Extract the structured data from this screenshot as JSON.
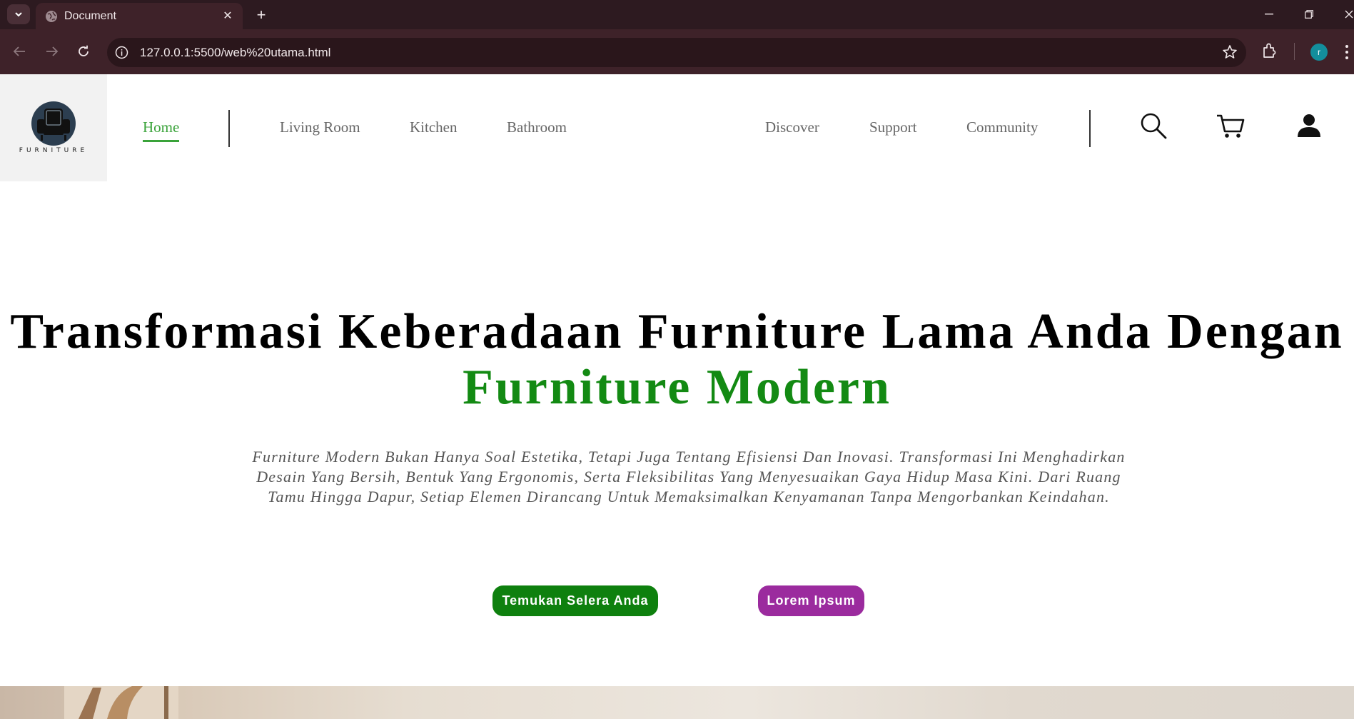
{
  "browser": {
    "tab_title": "Document",
    "url": "127.0.0.1:5500/web%20utama.html",
    "profile_initial": "r",
    "icons": [
      "tab-search-icon",
      "globe-icon",
      "close-icon",
      "plus-icon",
      "minimize-icon",
      "restore-icon",
      "close-window-icon",
      "back-arrow-icon",
      "forward-arrow-icon",
      "reload-icon",
      "info-icon",
      "star-icon",
      "extensions-icon",
      "kebab-menu-icon"
    ]
  },
  "site": {
    "logo_text": "FURNITURE",
    "nav_left": [
      "Home",
      "Living Room",
      "Kitchen",
      "Bathroom"
    ],
    "nav_right": [
      "Discover",
      "Support",
      "Community"
    ],
    "active_nav": "Home",
    "header_icons": [
      "search-icon",
      "cart-icon",
      "user-icon"
    ]
  },
  "hero": {
    "title": "Transformasi Keberadaan Furniture Lama Anda Dengan",
    "title_accent": "Furniture Modern",
    "description": "Furniture Modern Bukan Hanya Soal Estetika, Tetapi Juga Tentang Efisiensi Dan Inovasi. Transformasi Ini Menghadirkan Desain Yang Bersih, Bentuk Yang Ergonomis, Serta Fleksibilitas Yang Menyesuaikan Gaya Hidup Masa Kini. Dari Ruang Tamu Hingga Dapur, Setiap Elemen Dirancang Untuk Memaksimalkan Kenyamanan Tanpa Mengorbankan Keindahan.",
    "cta_primary": "Temukan Selera Anda",
    "cta_secondary": "Lorem Ipsum"
  },
  "colors": {
    "accent_green": "#138a13",
    "nav_active_green": "#3aa33a",
    "cta_purple": "#9b2b9e",
    "browser_frame": "#3e2229"
  }
}
